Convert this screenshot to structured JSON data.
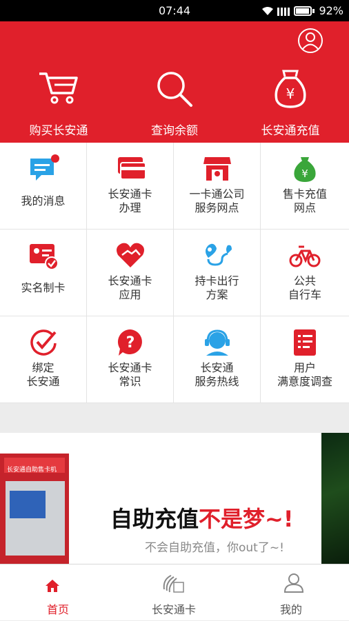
{
  "status": {
    "time": "07:44",
    "battery": "92%"
  },
  "header": {
    "actions": [
      {
        "label": "购买长安通"
      },
      {
        "label": "查询余额"
      },
      {
        "label": "长安通充值"
      }
    ]
  },
  "grid": {
    "items": [
      {
        "lines": [
          "我的消息"
        ]
      },
      {
        "lines": [
          "长安通卡",
          "办理"
        ]
      },
      {
        "lines": [
          "一卡通公司",
          "服务网点"
        ]
      },
      {
        "lines": [
          "售卡充值",
          "网点"
        ]
      },
      {
        "lines": [
          "实名制卡"
        ]
      },
      {
        "lines": [
          "长安通卡",
          "应用"
        ]
      },
      {
        "lines": [
          "持卡出行",
          "方案"
        ]
      },
      {
        "lines": [
          "公共",
          "自行车"
        ]
      },
      {
        "lines": [
          "绑定",
          "长安通"
        ]
      },
      {
        "lines": [
          "长安通卡",
          "常识"
        ]
      },
      {
        "lines": [
          "长安通",
          "服务热线"
        ]
      },
      {
        "lines": [
          "用户",
          "满意度调查"
        ]
      }
    ]
  },
  "banner": {
    "title_black": "自助充值",
    "title_red": "不是梦~!",
    "subtitle": "不会自助充值，你out了~!",
    "kiosk_header": "长安通自助售卡机"
  },
  "tabbar": {
    "tabs": [
      {
        "label": "首页",
        "active": true
      },
      {
        "label": "长安通卡",
        "active": false
      },
      {
        "label": "我的",
        "active": false
      }
    ]
  },
  "colors": {
    "brand_red": "#e0202b",
    "icon_blue": "#2aa2e6",
    "icon_green": "#3aa63a"
  }
}
